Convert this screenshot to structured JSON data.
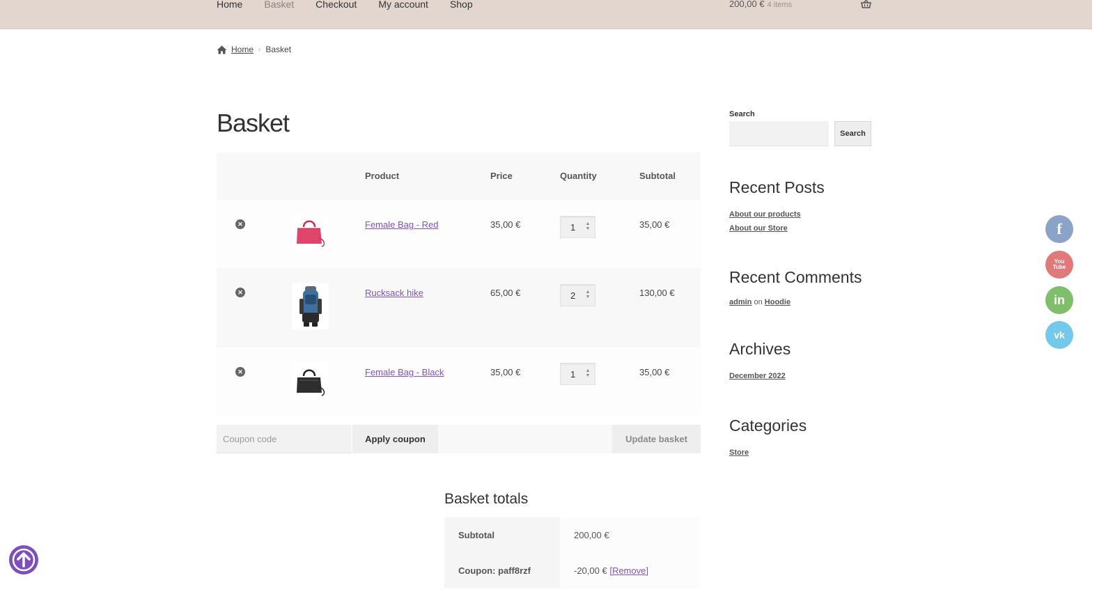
{
  "nav": {
    "items": [
      "Home",
      "Basket",
      "Checkout",
      "My account",
      "Shop"
    ],
    "cart_total": "200,00 €",
    "cart_count": "4 items"
  },
  "breadcrumb": {
    "home": "Home",
    "current": "Basket"
  },
  "page_title": "Basket",
  "table": {
    "headers": {
      "product": "Product",
      "price": "Price",
      "quantity": "Quantity",
      "subtotal": "Subtotal"
    },
    "rows": [
      {
        "name": "Female Bag - Red",
        "price": "35,00 €",
        "qty": "1",
        "subtotal": "35,00 €",
        "thumb": "red-bag"
      },
      {
        "name": "Rucksack hike",
        "price": "65,00 €",
        "qty": "2",
        "subtotal": "130,00 €",
        "thumb": "blue-rucksack"
      },
      {
        "name": "Female Bag - Black",
        "price": "35,00 €",
        "qty": "1",
        "subtotal": "35,00 €",
        "thumb": "black-bag"
      }
    ]
  },
  "actions": {
    "coupon_placeholder": "Coupon code",
    "apply": "Apply coupon",
    "update": "Update basket"
  },
  "totals": {
    "title": "Basket totals",
    "subtotal_label": "Subtotal",
    "subtotal_value": "200,00 €",
    "coupon_label": "Coupon: paff8rzf",
    "coupon_value": "-20,00 €",
    "coupon_remove": "[Remove]"
  },
  "sidebar": {
    "search_label": "Search",
    "search_button": "Search",
    "recent_posts_title": "Recent Posts",
    "recent_posts": [
      "About our products",
      "About our Store"
    ],
    "recent_comments_title": "Recent Comments",
    "comment_author": "admin",
    "comment_on": "on",
    "comment_post": "Hoodie",
    "archives_title": "Archives",
    "archives": [
      "December 2022"
    ],
    "categories_title": "Categories",
    "categories": [
      "Store"
    ]
  },
  "social": {
    "facebook": "f",
    "youtube_top": "You",
    "youtube_bottom": "Tube",
    "linkedin": "in",
    "vk": "vk"
  },
  "colors": {
    "accent": "#7f54b3",
    "topbar": "#e2d6ce"
  }
}
